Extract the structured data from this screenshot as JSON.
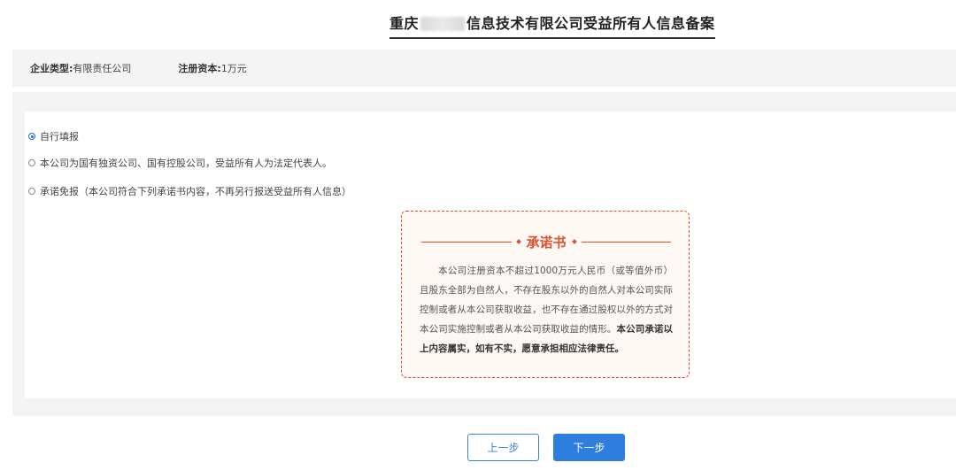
{
  "header": {
    "title_prefix": "重庆",
    "title_suffix": "信息技术有限公司受益所有人信息备案"
  },
  "info_bar": {
    "company_type_key": "企业类型:",
    "company_type_value": "有限责任公司",
    "capital_key": "注册资本:",
    "capital_value": "1万元"
  },
  "options": [
    {
      "label": "自行填报",
      "checked": true
    },
    {
      "label": "本公司为国有独资公司、国有控股公司，受益所有人为法定代表人。",
      "checked": false
    },
    {
      "label": "承诺免报（本公司符合下列承诺书内容，不再另行报送受益所有人信息）",
      "checked": false
    }
  ],
  "pledge": {
    "title": "承诺书",
    "body_normal": "本公司注册资本不超过1000万元人民币（或等值外币）且股东全部为自然人，不存在股东以外的自然人对本公司实际控制或者从本公司获取收益，也不存在通过股权以外的方式对本公司实施控制或者从本公司获取收益的情形。",
    "body_bold": "本公司承诺以上内容属实，如有不实，愿意承担相应法律责任。"
  },
  "buttons": {
    "prev": "上一步",
    "next": "下一步"
  }
}
